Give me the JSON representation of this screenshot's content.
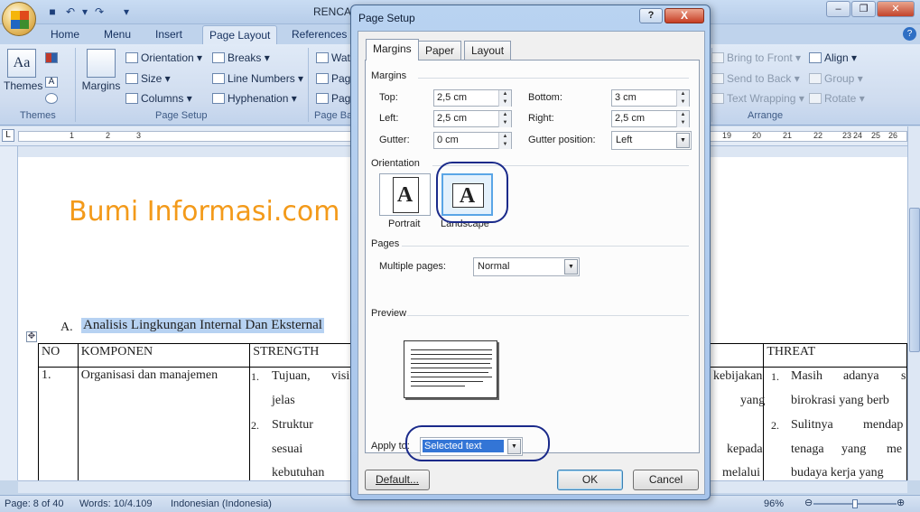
{
  "window": {
    "title": "RENCAN",
    "min_icon": "minimize-icon",
    "max_icon": "maximize-icon",
    "close_icon": "close-icon"
  },
  "ribbon": {
    "tabs": [
      "Home",
      "Menu",
      "Insert",
      "Page Layout",
      "References"
    ],
    "active_tab": "Page Layout",
    "themes": {
      "label": "Themes",
      "group": "Themes"
    },
    "page_setup": {
      "margins": "Margins",
      "orientation": "Orientation",
      "size": "Size",
      "columns": "Columns",
      "breaks": "Breaks",
      "line_numbers": "Line Numbers",
      "hyphenation": "Hyphenation",
      "group": "Page Setup"
    },
    "page_bg": {
      "wat": "Wat",
      "pag1": "Pag",
      "pag2": "Pag",
      "group": "Page Ba"
    },
    "arrange": {
      "bring_front": "Bring to Front",
      "send_back": "Send to Back",
      "text_wrapping": "Text Wrapping",
      "align": "Align",
      "group_btn": "Group",
      "rotate": "Rotate",
      "group": "Arrange"
    }
  },
  "ruler": {
    "ticks": [
      "1",
      "2",
      "3",
      "19",
      "20",
      "21",
      "22",
      "23",
      "24",
      "25",
      "26"
    ]
  },
  "document": {
    "watermark": "Bumi Informasi.com",
    "heading_num": "A.",
    "heading": "Analisis Lingkungan Internal  Dan Eksternal",
    "table": {
      "headers": [
        "NO",
        "KOMPONEN",
        "STRENGTH",
        "THREAT"
      ],
      "row1": {
        "no": "1.",
        "komponen": "Organisasi dan manajemen"
      },
      "strength_lines": [
        "1.",
        "Tujuan,",
        "visi",
        "jelas",
        "2.",
        "Struktur",
        "sesuai",
        "kebutuhan"
      ],
      "middle_lines": [
        "kebijakan",
        "yang",
        "kepada",
        "melalui"
      ],
      "threat_lines": [
        "1.",
        "Masih",
        "adanya",
        "s",
        "birokrasi yang berb",
        "2.",
        "Sulitnya",
        "mendap",
        "tenaga",
        "yang",
        "me",
        "budaya kerja yang"
      ]
    }
  },
  "status": {
    "page": "Page: 8 of 40",
    "words": "Words: 10/4.109",
    "language": "Indonesian (Indonesia)",
    "zoom": "96%",
    "zoom_level": 0.5
  },
  "dialog": {
    "title": "Page Setup",
    "help": "?",
    "close": "X",
    "tabs": [
      "Margins",
      "Paper",
      "Layout"
    ],
    "active_tab": "Margins",
    "margins_section": "Margins",
    "top": {
      "label": "Top:",
      "value": "2,5 cm"
    },
    "bottom": {
      "label": "Bottom:",
      "value": "3 cm"
    },
    "left": {
      "label": "Left:",
      "value": "2,5 cm"
    },
    "right": {
      "label": "Right:",
      "value": "2,5 cm"
    },
    "gutter": {
      "label": "Gutter:",
      "value": "0 cm"
    },
    "gutter_position": {
      "label": "Gutter position:",
      "value": "Left"
    },
    "orientation_section": "Orientation",
    "portrait": "Portrait",
    "landscape": "Landscape",
    "pages_section": "Pages",
    "multiple_pages": {
      "label": "Multiple pages:",
      "value": "Normal"
    },
    "preview_section": "Preview",
    "apply_to": {
      "label": "Apply to:",
      "value": "Selected text"
    },
    "default_btn": "Default...",
    "ok_btn": "OK",
    "cancel_btn": "Cancel"
  }
}
